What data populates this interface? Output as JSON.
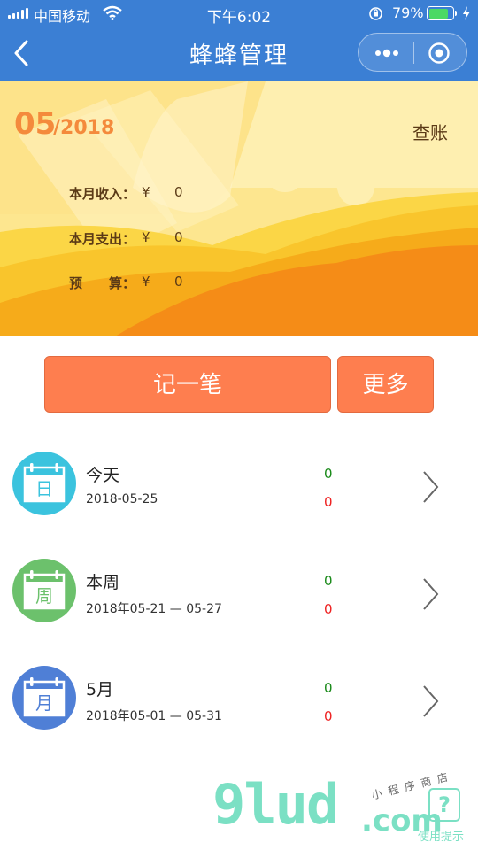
{
  "status_bar": {
    "carrier": "中国移动",
    "time": "下午6:02",
    "battery": "79%"
  },
  "nav": {
    "title": "蜂蜂管理"
  },
  "banner": {
    "month": "05",
    "year": "/2018",
    "check_link": "查账",
    "stats": [
      {
        "label": "本月收入：",
        "currency": "¥",
        "value": "0"
      },
      {
        "label": "本月支出：",
        "currency": "¥",
        "value": "0"
      },
      {
        "label": "预　　算：",
        "currency": "¥",
        "value": "0"
      }
    ]
  },
  "actions": {
    "record": "记一笔",
    "more": "更多"
  },
  "rows": [
    {
      "icon_char": "日",
      "name": "今天",
      "date": "2018-05-25",
      "income": "0",
      "expense": "0",
      "color": "#3bc3de"
    },
    {
      "icon_char": "周",
      "name": "本周",
      "date": "2018年05-21 — 05-27",
      "income": "0",
      "expense": "0",
      "color": "#6cc16c"
    },
    {
      "icon_char": "月",
      "name": "5月",
      "date": "2018年05-01 — 05-31",
      "income": "0",
      "expense": "0",
      "color": "#4f7fd6"
    }
  ],
  "watermark": {
    "logo": "9lud",
    "domain": ".com",
    "handwriting": "小程序商店",
    "help": "使用提示"
  },
  "colors": {
    "nav_blue": "#3b7fd4",
    "button_orange": "#fe7e4f",
    "income_green": "#1a8a1a",
    "expense_red": "#e22222"
  }
}
